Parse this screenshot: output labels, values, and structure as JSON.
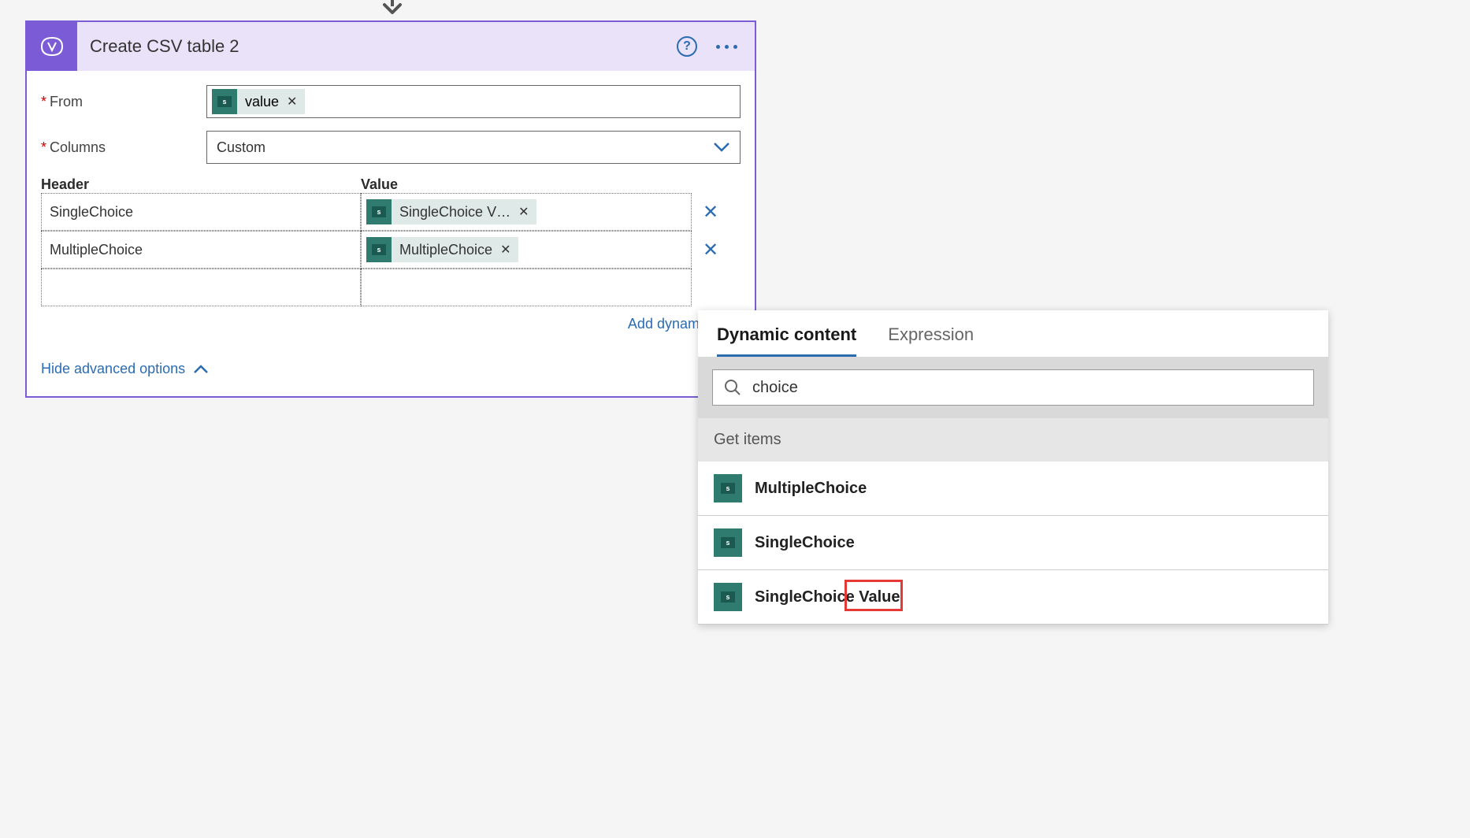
{
  "card": {
    "title": "Create CSV table 2",
    "from_label": "From",
    "columns_label": "Columns",
    "columns_mode": "Custom",
    "from_token": "value",
    "headers": {
      "header": "Header",
      "value": "Value"
    },
    "rows": [
      {
        "header": "SingleChoice",
        "value_token": "SingleChoice V…"
      },
      {
        "header": "MultipleChoice",
        "value_token": "MultipleChoice"
      }
    ],
    "add_dynamic": "Add dynamic cont",
    "hide_advanced": "Hide advanced options"
  },
  "dyn": {
    "tab_content": "Dynamic content",
    "tab_expression": "Expression",
    "search_value": "choice",
    "section": "Get items",
    "items": [
      {
        "label": "MultipleChoice"
      },
      {
        "label": "SingleChoice"
      },
      {
        "label_a": "SingleChoice ",
        "label_b": "Value"
      }
    ]
  }
}
